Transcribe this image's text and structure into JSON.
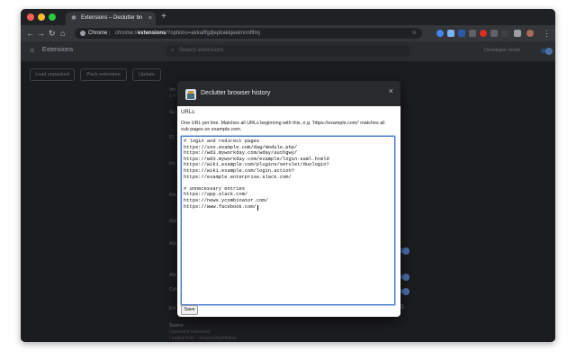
{
  "browser": {
    "tab_title": "Extensions – Declutter browser history",
    "new_tab": "+",
    "omnibox": {
      "scheme_label": "Chrome",
      "separator": "|",
      "url_prefix": "chrome://",
      "url_host": "extensions",
      "url_path": "/?options=akkaiffgdjepbakkjeeimnnflfmj"
    },
    "traffic_colors": [
      "#ff5f57",
      "#febc2e",
      "#28c840"
    ],
    "extension_icon_colors": [
      "#4285f4",
      "#7ab3f4",
      "#2b5aa8",
      "#5f6368",
      "#d93025",
      "#5f6368",
      "#3c4043",
      "#9aa0a6"
    ]
  },
  "extensions_page": {
    "title": "Extensions",
    "search_placeholder": "Search extensions",
    "developer_mode_label": "Developer mode",
    "buttons": {
      "load_unpacked": "Load unpacked",
      "pack_extension": "Pack extension",
      "update": "Update"
    },
    "detail_fragments": {
      "version_partial": "Ver",
      "version_value_partial": "1.4",
      "row2": "Siz",
      "row3": "ID",
      "row4": "Ins",
      "row5": "Per",
      "row6": "Site",
      "row7": "Allo",
      "row8": "Allo",
      "row9": "Coll",
      "row10": "Ext",
      "source_label": "Source",
      "source_value": "Unpacked extension",
      "loaded_from": "Loaded from: ~/source/histHistory"
    }
  },
  "dialog": {
    "title": "Declutter browser history",
    "close": "×",
    "urls_label": "URLs",
    "help_text": "One URL per line. Matches all URLs beginning with this, e.g. 'https://example.com/' matches all sub pages on example.com.",
    "textarea_lines": [
      "# login and redirect pages",
      "https://sso.example.com/dag/module.php/",
      "https://wd3.myworkday.com/wday/authgwy/",
      "https://wd3.myworkday.com/example/login-saml.htmld",
      "https://wiki.example.com/plugins/servlet/duologin?",
      "https://wiki.example.com/login.action?",
      "https://example.enterprise.slack.com/",
      "",
      "# unnecessary entries",
      "https://app.slack.com/",
      "https://news.ycombinator.com/",
      "https://www.facebook.com/"
    ],
    "save_label": "Save"
  }
}
